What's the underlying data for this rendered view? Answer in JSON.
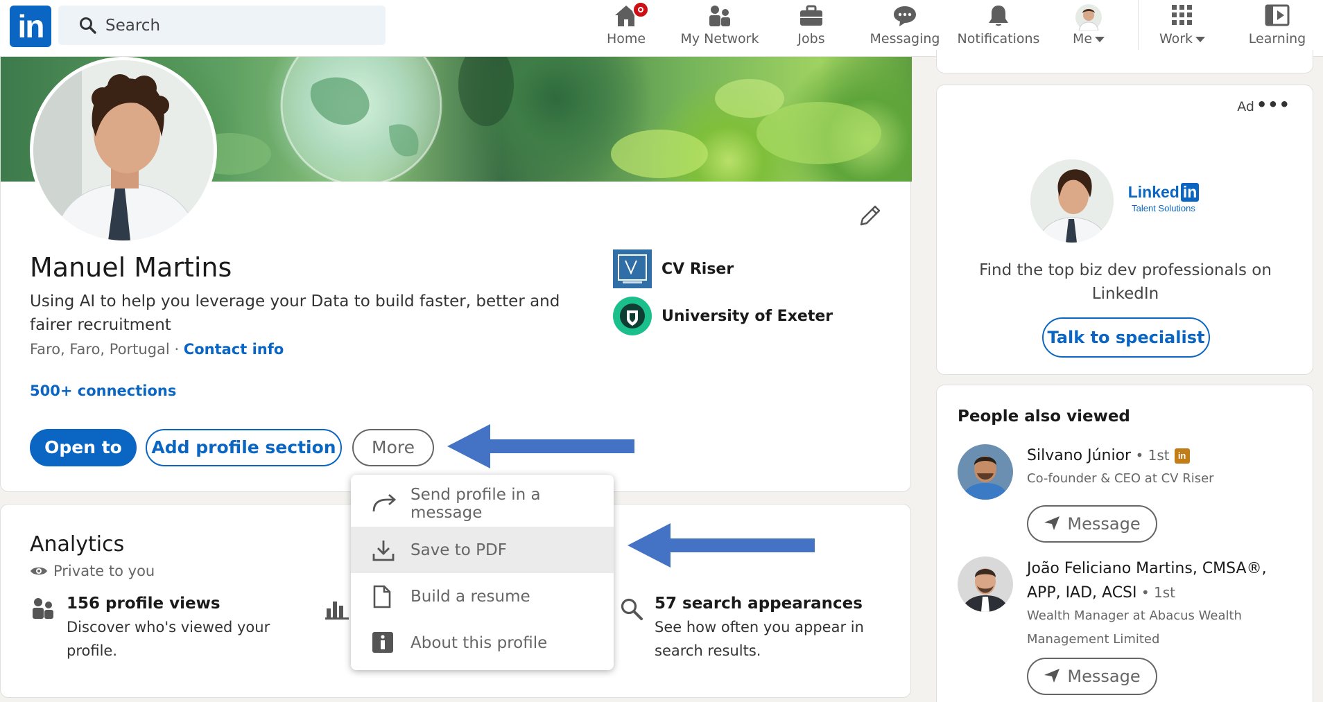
{
  "nav": {
    "logo_text": "in",
    "search_placeholder": "Search",
    "items": [
      {
        "label": "Home",
        "icon": "home-icon"
      },
      {
        "label": "My Network",
        "icon": "network-icon"
      },
      {
        "label": "Jobs",
        "icon": "briefcase-icon"
      },
      {
        "label": "Messaging",
        "icon": "messaging-icon"
      },
      {
        "label": "Notifications",
        "icon": "bell-icon"
      },
      {
        "label": "Me",
        "icon": "avatar"
      },
      {
        "label": "Work",
        "icon": "grid-icon"
      },
      {
        "label": "Learning",
        "icon": "learning-icon"
      }
    ]
  },
  "profile": {
    "name": "Manuel Martins",
    "headline": "Using AI to help you leverage your Data to build faster, better and fairer recruitment",
    "location": "Faro, Faro, Portugal",
    "separator": " · ",
    "contact_info": "Contact info",
    "connections": "500+ connections",
    "orgs": [
      {
        "name": "CV Riser",
        "icon": "cv-riser-logo"
      },
      {
        "name": "University of Exeter",
        "icon": "exeter-crest-logo"
      }
    ],
    "buttons": {
      "open_to": "Open to",
      "add_section": "Add profile section",
      "more": "More"
    }
  },
  "more_menu": {
    "items": [
      {
        "label": "Send profile in a message",
        "icon": "share-arrow-icon"
      },
      {
        "label": "Save to PDF",
        "icon": "download-icon"
      },
      {
        "label": "Build a resume",
        "icon": "document-icon"
      },
      {
        "label": "About this profile",
        "icon": "info-icon"
      }
    ],
    "highlighted_index": 1
  },
  "analytics": {
    "title": "Analytics",
    "private": "Private to you",
    "items": [
      {
        "head": "156 profile views",
        "desc": "Discover who's viewed your profile."
      },
      {
        "head": "57 search appearances",
        "desc": "See how often you appear in search results."
      }
    ]
  },
  "ad": {
    "label": "Ad",
    "dots": "•••",
    "logo_word": "Linked",
    "logo_in": "in",
    "logo_sub": "Talent Solutions",
    "text": "Find the top biz dev professionals on LinkedIn",
    "button": "Talk to specialist"
  },
  "people_also_viewed": {
    "title": "People also viewed",
    "people": [
      {
        "name": "Silvano Júnior",
        "degree": " • 1st",
        "subtitle": "Co-founder & CEO at CV Riser",
        "button": "Message"
      },
      {
        "name": "João Feliciano Martins, CMSA®, APP, IAD, ACSI",
        "degree": " • 1st",
        "subtitle": "Wealth Manager at Abacus Wealth Management Limited",
        "button": "Message"
      }
    ]
  },
  "colors": {
    "brand": "#0a66c2",
    "arrow": "#4472c4",
    "notification": "#cc1016"
  }
}
